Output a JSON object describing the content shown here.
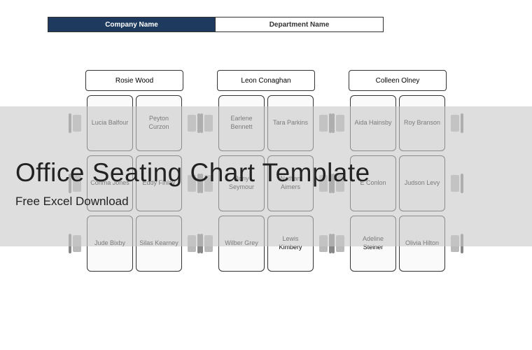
{
  "header": {
    "company_label": "Company Name",
    "department_label": "Department Name"
  },
  "clusters": [
    {
      "head": "Rosie Wood",
      "rows": [
        [
          "Lucia Balfour",
          "Peyton Curzon"
        ],
        [
          "Conma Jones",
          "Eddy Finlay"
        ],
        [
          "Jude Bixby",
          "Silas Kearney"
        ]
      ]
    },
    {
      "head": "Leon Conaghan",
      "rows": [
        [
          "Earlene Bennett",
          "Tara Parkins"
        ],
        [
          "Rony Seymour",
          "Nathan Aimers"
        ],
        [
          "Wilber Grey",
          "Lewis Kimbery"
        ]
      ]
    },
    {
      "head": "Colleen Olney",
      "rows": [
        [
          "Aida Hainsby",
          "Roy Branson"
        ],
        [
          "E Conlon",
          "Judson Levy"
        ],
        [
          "Adeline Steiner",
          "Olivia Hilton"
        ]
      ]
    }
  ],
  "overlay": {
    "title": "Office Seating Chart Template",
    "subtitle": "Free Excel Download"
  }
}
